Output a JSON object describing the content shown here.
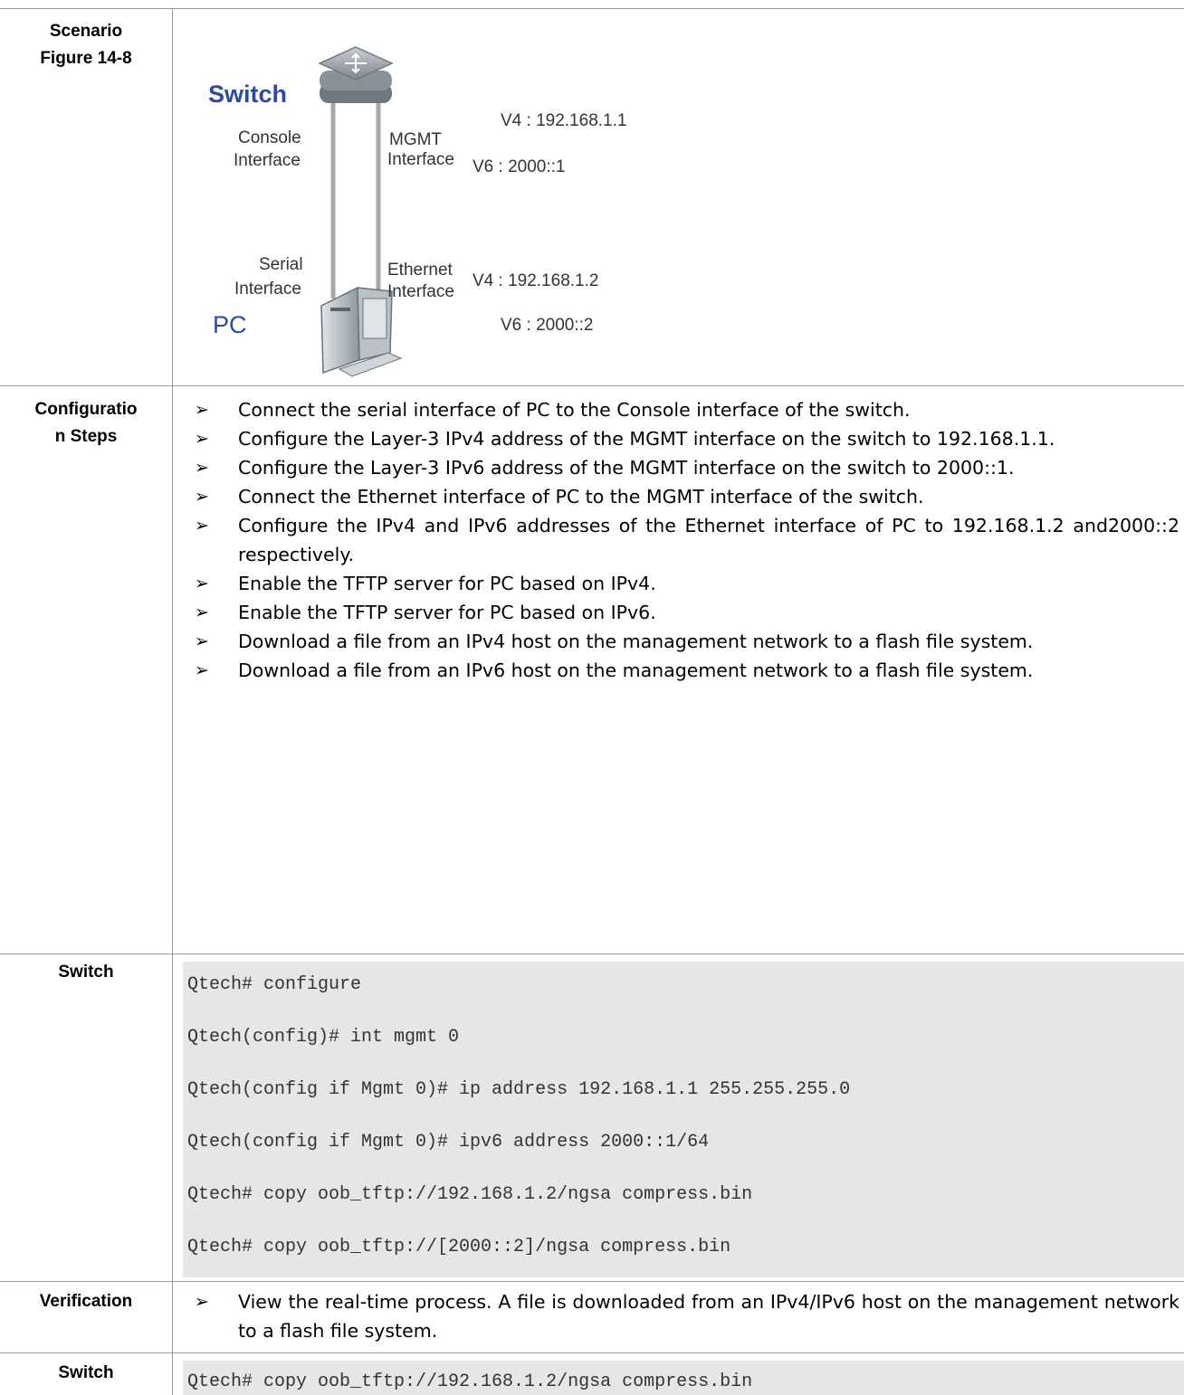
{
  "rows": {
    "scenario": {
      "label_line1": "Scenario",
      "label_line2": "Figure 14-8"
    },
    "config_steps": {
      "label_line1": "Configuratio",
      "label_line2": "n Steps",
      "bullets": [
        "Connect the serial interface of PC to the Console interface of the switch.",
        "Configure the Layer-3 IPv4 address of the MGMT interface on the switch to 192.168.1.1.",
        "Configure the Layer-3 IPv6 address of the MGMT interface on the switch to 2000::1.",
        "Connect the Ethernet interface of PC to the MGMT interface of the switch.",
        "Configure the IPv4 and IPv6 addresses of the Ethernet interface of PC to 192.168.1.2 and2000::2 respectively.",
        "Enable the TFTP server for PC based on IPv4.",
        "Enable the TFTP server for PC based on IPv6.",
        "Download a file from an IPv4 host on the management network to a flash file system.",
        "Download a file from an IPv6 host on the management network to a flash file system."
      ]
    },
    "switch_config": {
      "label": "Switch",
      "code_lines": [
        "Qtech# configure",
        "Qtech(config)# int mgmt 0",
        "Qtech(config if Mgmt 0)# ip address 192.168.1.1 255.255.255.0",
        "Qtech(config if Mgmt 0)# ipv6 address 2000::1/64",
        "Qtech# copy oob_tftp://192.168.1.2/ngsa compress.bin",
        "Qtech# copy oob_tftp://[2000::2]/ngsa compress.bin"
      ]
    },
    "verification": {
      "label": "Verification",
      "bullets": [
        "View the real-time process. A file is downloaded from an IPv4/IPv6 host on the management network to a flash file system."
      ]
    },
    "switch_verify": {
      "label": "Switch",
      "code_lines": [
        "Qtech# copy oob_tftp://192.168.1.2/ngsa compress.bin"
      ]
    }
  },
  "figure": {
    "switch_title": "Switch",
    "pc_title": "PC",
    "console_label_1": "Console",
    "console_label_2": "Interface",
    "mgmt_label_1": "MGMT",
    "mgmt_label_2": "Interface",
    "serial_label_1": "Serial",
    "serial_label_2": "Interface",
    "ethernet_label_1": "Ethernet",
    "ethernet_label_2": "Interface",
    "switch_v4": "V4 : 192.168.1.1",
    "switch_v6": "V6 : 2000::1",
    "pc_v4": "V4 : 192.168.1.2",
    "pc_v6": "V6 : 2000::2",
    "colors": {
      "title_blue": "#2b4aa0",
      "label_gray": "#333333",
      "cable": "#a8a8a8"
    }
  }
}
